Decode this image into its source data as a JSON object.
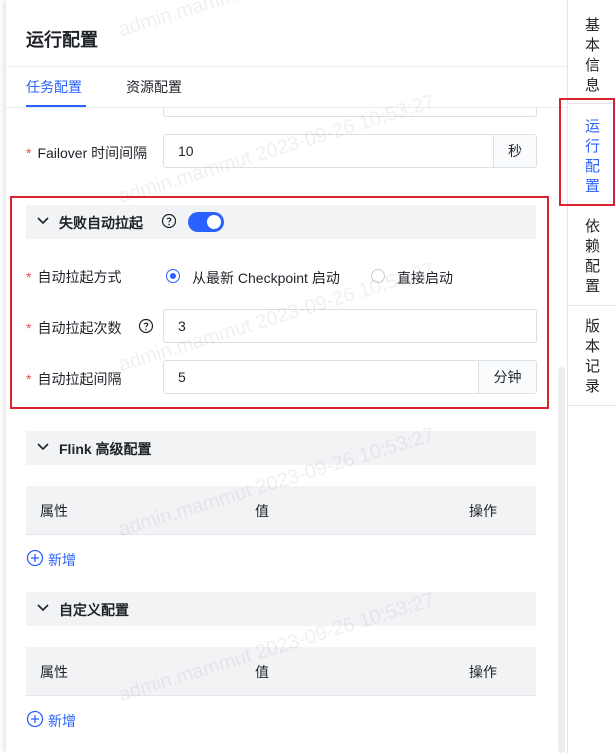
{
  "panel": {
    "title": "运行配置"
  },
  "tabs": [
    {
      "label": "任务配置",
      "active": true
    },
    {
      "label": "资源配置",
      "active": false
    }
  ],
  "failover": {
    "label": "Failover 时间间隔",
    "value": "10",
    "unit": "秒"
  },
  "auto_restart": {
    "section_title": "失败自动拉起",
    "enabled": true,
    "mode_label": "自动拉起方式",
    "modes": [
      {
        "label": "从最新 Checkpoint 启动",
        "checked": true
      },
      {
        "label": "直接启动",
        "checked": false
      }
    ],
    "count_label": "自动拉起次数",
    "count_value": "3",
    "interval_label": "自动拉起间隔",
    "interval_value": "5",
    "interval_unit": "分钟"
  },
  "flink_advanced": {
    "section_title": "Flink 高级配置",
    "columns": [
      "属性",
      "值",
      "操作"
    ],
    "add_label": "新增"
  },
  "custom_config": {
    "section_title": "自定义配置",
    "columns": [
      "属性",
      "值",
      "操作"
    ],
    "add_label": "新增"
  },
  "side_nav": [
    {
      "label": "基本信息",
      "active": false
    },
    {
      "label": "运行配置",
      "active": true
    },
    {
      "label": "依赖配置",
      "active": false
    },
    {
      "label": "版本记录",
      "active": false
    }
  ],
  "watermark": "admin.mammut 2023-09-26 10:53:27",
  "colors": {
    "accent": "#2a62ff",
    "required": "#e34d59",
    "highlight_box": "#d9232e"
  }
}
